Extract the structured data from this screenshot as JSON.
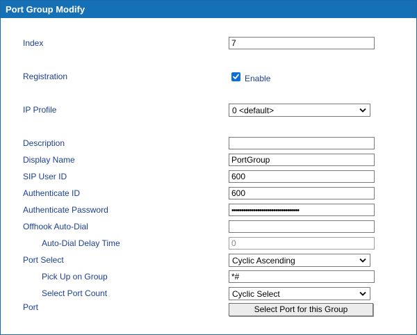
{
  "header": {
    "title": "Port Group Modify"
  },
  "fields": {
    "index": {
      "label": "Index",
      "value": "7"
    },
    "registration": {
      "label": "Registration",
      "checked": true,
      "checkbox_label": "Enable"
    },
    "ip_profile": {
      "label": "IP Profile",
      "selected": "0 <default>"
    },
    "description": {
      "label": "Description",
      "value": ""
    },
    "display_name": {
      "label": "Display Name",
      "value": "PortGroup"
    },
    "sip_user_id": {
      "label": "SIP User ID",
      "value": "600"
    },
    "authenticate_id": {
      "label": "Authenticate ID",
      "value": "600"
    },
    "authenticate_password": {
      "label": "Authenticate Password",
      "value": "••••••••••••••••••••••••••••••••••"
    },
    "offhook_auto_dial": {
      "label": "Offhook Auto-Dial",
      "value": ""
    },
    "auto_dial_delay_time": {
      "label": "Auto-Dial Delay Time",
      "value": "0"
    },
    "port_select": {
      "label": "Port Select",
      "selected": "Cyclic Ascending"
    },
    "pick_up_on_group": {
      "label": "Pick Up on Group",
      "value": "*#"
    },
    "select_port_count": {
      "label": "Select Port Count",
      "selected": "Cyclic Select"
    },
    "port": {
      "label": "Port",
      "button_label": "Select Port for this Group"
    }
  },
  "colors": {
    "header_bg": "#1670b5",
    "label_text": "#1c3f8f",
    "checkbox": "#0a6fd8"
  },
  "icons": {
    "dropdown": "chevron-down-icon",
    "check": "check-icon"
  }
}
